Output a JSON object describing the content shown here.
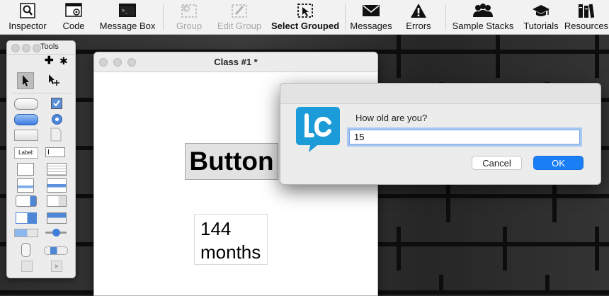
{
  "toolbar": {
    "items": [
      {
        "label": "Inspector",
        "icon": "inspector-icon"
      },
      {
        "label": "Code",
        "icon": "code-icon"
      },
      {
        "label": "Message Box",
        "icon": "message-box-icon"
      },
      {
        "label": "Group",
        "icon": "group-icon",
        "disabled": true
      },
      {
        "label": "Edit Group",
        "icon": "edit-group-icon",
        "disabled": true
      },
      {
        "label": "Select Grouped",
        "icon": "select-grouped-icon"
      },
      {
        "label": "Messages",
        "icon": "envelope-icon"
      },
      {
        "label": "Errors",
        "icon": "warning-icon"
      },
      {
        "label": "Sample Stacks",
        "icon": "people-icon"
      },
      {
        "label": "Tutorials",
        "icon": "graduation-cap-icon"
      },
      {
        "label": "Resources",
        "icon": "books-icon"
      }
    ]
  },
  "tools_palette": {
    "title": "Tools",
    "label_tool": "Label:"
  },
  "card_window": {
    "title": "Class #1 *",
    "button_label": "Button",
    "field_line1": "144",
    "field_line2": "months"
  },
  "dialog": {
    "prompt": "How old are you?",
    "answer_value": "15",
    "cancel_label": "Cancel",
    "ok_label": "OK",
    "logo_text": "lc"
  },
  "colors": {
    "accent": "#1a7ef5",
    "logo": "#1b9bd7"
  }
}
